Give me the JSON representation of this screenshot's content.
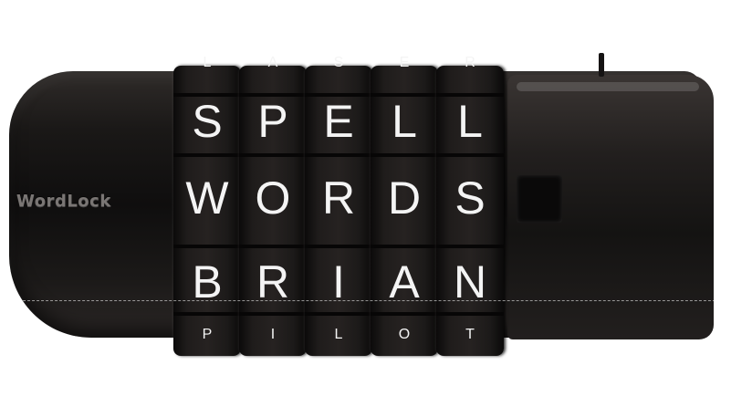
{
  "brand": "WordLock",
  "rows": {
    "top": [
      "L",
      "A",
      "S",
      "E",
      "R"
    ],
    "row1": [
      "S",
      "P",
      "E",
      "L",
      "L"
    ],
    "row2": [
      "W",
      "O",
      "R",
      "D",
      "S"
    ],
    "row3": [
      "B",
      "R",
      "I",
      "A",
      "N"
    ],
    "bottom": [
      "P",
      "I",
      "L",
      "O",
      "T"
    ]
  }
}
